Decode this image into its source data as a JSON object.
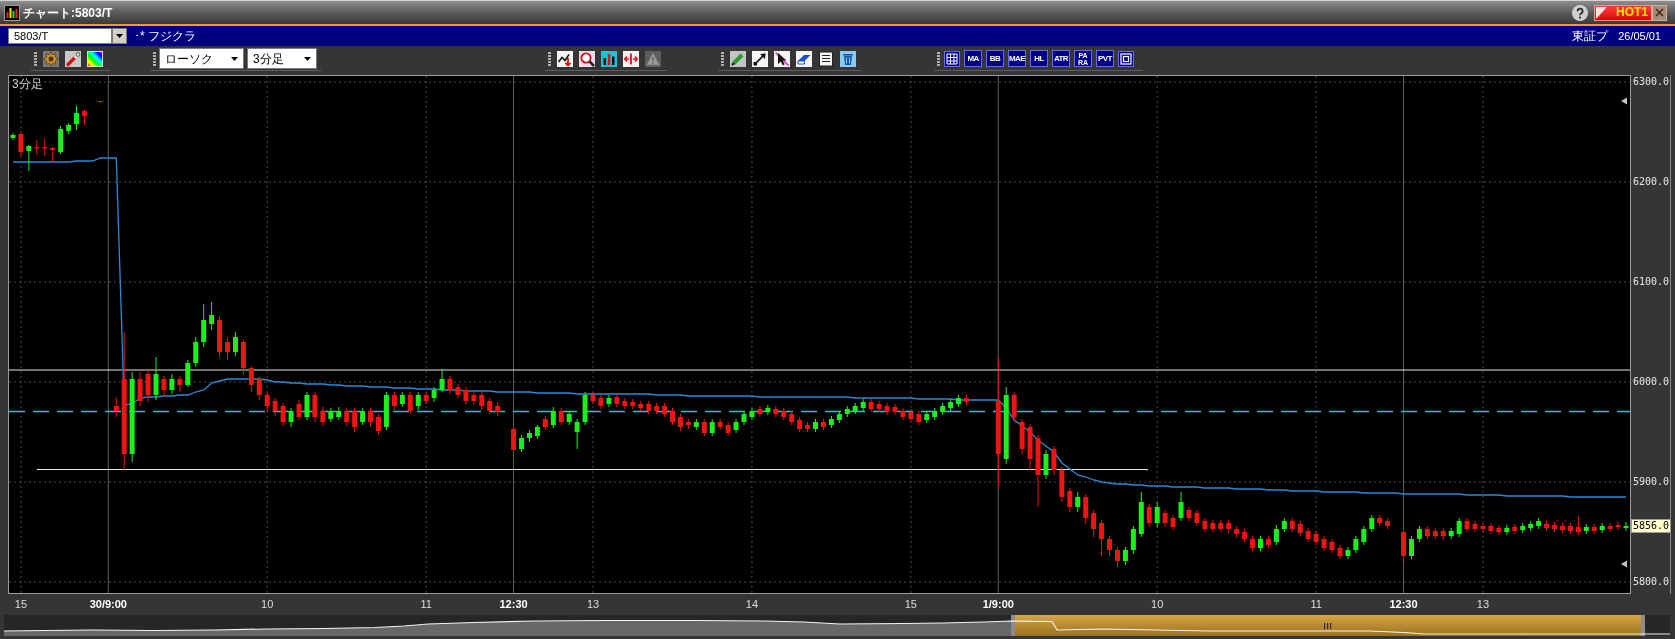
{
  "window": {
    "title": "チャート:5803/T",
    "hot_button": "HOT1"
  },
  "symbol_bar": {
    "symbol": "5803/T",
    "name": "･* フジクラ",
    "market": "東証プ",
    "date": "26/05/01"
  },
  "toolbar": {
    "chart_type": "ローソク",
    "interval": "3分足",
    "analysis_tools": [
      {
        "disabled": false
      },
      {
        "disabled": false
      },
      {
        "disabled": false
      },
      {
        "disabled": false
      },
      {
        "disabled": true
      }
    ],
    "indicators": [
      {
        "label": "MA",
        "kind": "single"
      },
      {
        "label": "BB",
        "kind": "single"
      },
      {
        "label": "MAE",
        "kind": "single"
      },
      {
        "label": "HL",
        "kind": "single"
      },
      {
        "label": "ATR",
        "kind": "single"
      },
      {
        "label": "PARA",
        "kind": "stacked"
      },
      {
        "label": "PVT",
        "kind": "single"
      }
    ]
  },
  "chart": {
    "interval_label": "3分足",
    "last_price": "5856.0",
    "x_tick_styles": [
      {
        "kind": "hour"
      },
      {
        "kind": "session"
      },
      {
        "kind": "hour"
      },
      {
        "kind": "hour"
      },
      {
        "kind": "session"
      },
      {
        "kind": "hour"
      },
      {
        "kind": "hour"
      },
      {
        "kind": "hour"
      },
      {
        "kind": "session"
      },
      {
        "kind": "hour"
      },
      {
        "kind": "hour"
      },
      {
        "kind": "session"
      },
      {
        "kind": "hour"
      }
    ],
    "chart_data": {
      "type": "candlestick",
      "ylim": [
        5789,
        6306
      ],
      "grid": true,
      "yticks": [
        {
          "value": 6300,
          "label": "6300.0"
        },
        {
          "value": 6200,
          "label": "6200.0"
        },
        {
          "value": 6100,
          "label": "6100.0"
        },
        {
          "value": 6000,
          "label": "6000.0"
        },
        {
          "value": 5900,
          "label": "5900.0"
        },
        {
          "value": 5800,
          "label": "5800.0"
        }
      ],
      "ref_lines": [
        {
          "axis": "y",
          "value": 6012,
          "color": "#e8e8e8"
        },
        {
          "axis": "y",
          "value": 5970,
          "color": "#22c4dc"
        },
        {
          "axis": "y",
          "value": 5912,
          "color": "#e8e8e8"
        }
      ],
      "categories": [
        null,
        "15",
        null,
        null,
        null,
        null,
        null,
        null,
        null,
        null,
        null,
        null,
        "30/9:00",
        null,
        null,
        null,
        null,
        null,
        null,
        null,
        null,
        null,
        null,
        null,
        null,
        null,
        null,
        null,
        null,
        null,
        null,
        null,
        "10",
        null,
        null,
        null,
        null,
        null,
        null,
        null,
        null,
        null,
        null,
        null,
        null,
        null,
        null,
        null,
        null,
        null,
        null,
        null,
        "11",
        null,
        null,
        null,
        null,
        null,
        null,
        null,
        null,
        null,
        null,
        "12:30",
        null,
        null,
        null,
        null,
        null,
        null,
        null,
        null,
        null,
        "13",
        null,
        null,
        null,
        null,
        null,
        null,
        null,
        null,
        null,
        null,
        null,
        null,
        null,
        null,
        null,
        null,
        null,
        null,
        null,
        "14",
        null,
        null,
        null,
        null,
        null,
        null,
        null,
        null,
        null,
        null,
        null,
        null,
        null,
        null,
        null,
        null,
        null,
        null,
        null,
        "15",
        null,
        null,
        null,
        null,
        null,
        null,
        null,
        null,
        null,
        null,
        "1/9:00",
        null,
        null,
        null,
        null,
        null,
        null,
        null,
        null,
        null,
        null,
        null,
        null,
        null,
        null,
        null,
        null,
        null,
        null,
        null,
        "10",
        null,
        null,
        null,
        null,
        null,
        null,
        null,
        null,
        null,
        null,
        null,
        null,
        null,
        null,
        null,
        null,
        null,
        null,
        null,
        "11",
        null,
        null,
        null,
        null,
        null,
        null,
        null,
        null,
        null,
        null,
        "12:30",
        null,
        null,
        null,
        null,
        null,
        null,
        null,
        null,
        null,
        "13",
        null,
        null,
        null,
        null,
        null,
        null,
        null,
        null,
        null,
        null,
        null,
        null,
        null,
        null,
        null,
        null,
        null,
        null
      ],
      "ohlc": [
        [
          6244,
          6249,
          6242,
          6247
        ],
        [
          6248,
          6250,
          6226,
          6230
        ],
        [
          6231,
          6237,
          6211,
          6236
        ],
        [
          6235,
          6242,
          6227,
          6235
        ],
        [
          6235,
          6243,
          6226,
          6235
        ],
        [
          6234,
          6235,
          6219,
          6232
        ],
        [
          6230,
          6256,
          6228,
          6253
        ],
        [
          6251,
          6259,
          6248,
          6257
        ],
        [
          6258,
          6276,
          6252,
          6269
        ],
        [
          6271,
          6273,
          6257,
          6266
        ],
        null,
        [
          6281,
          6281,
          6281,
          6281
        ],
        null,
        [
          5976,
          5985,
          5965,
          5971
        ],
        [
          6003,
          6050,
          5912,
          5928
        ],
        [
          5928,
          6010,
          5920,
          6003
        ],
        [
          6003,
          6010,
          5976,
          5981
        ],
        [
          6008,
          6012,
          5980,
          5987
        ],
        [
          5987,
          6025,
          5982,
          6008
        ],
        [
          6003,
          6006,
          5985,
          5992
        ],
        [
          5992,
          6008,
          5988,
          6003
        ],
        [
          6003,
          6006,
          5990,
          5997
        ],
        [
          5997,
          6022,
          5995,
          6019
        ],
        [
          6019,
          6045,
          6015,
          6040
        ],
        [
          6040,
          6078,
          6035,
          6062
        ],
        [
          6058,
          6080,
          6052,
          6067
        ],
        [
          6062,
          6066,
          6025,
          6030
        ],
        [
          6040,
          6045,
          6022,
          6030
        ],
        [
          6030,
          6050,
          6026,
          6045
        ],
        [
          6040,
          6042,
          6008,
          6014
        ],
        [
          6014,
          6016,
          5990,
          5997
        ],
        [
          6003,
          6005,
          5982,
          5987
        ],
        [
          5987,
          5990,
          5970,
          5976
        ],
        [
          5981,
          5984,
          5966,
          5971
        ],
        [
          5976,
          5979,
          5956,
          5960
        ],
        [
          5960,
          5974,
          5955,
          5971
        ],
        [
          5978,
          5982,
          5962,
          5965
        ],
        [
          5965,
          5990,
          5962,
          5987
        ],
        [
          5987,
          5990,
          5960,
          5965
        ],
        [
          5971,
          5975,
          5956,
          5960
        ],
        [
          5963,
          5974,
          5960,
          5971
        ],
        [
          5965,
          5975,
          5962,
          5971
        ],
        [
          5971,
          5974,
          5956,
          5960
        ],
        [
          5971,
          5974,
          5950,
          5955
        ],
        [
          5960,
          5974,
          5957,
          5971
        ],
        [
          5971,
          5974,
          5955,
          5960
        ],
        [
          5965,
          5968,
          5947,
          5951
        ],
        [
          5955,
          5990,
          5952,
          5987
        ],
        [
          5987,
          5990,
          5972,
          5976
        ],
        [
          5978,
          5990,
          5975,
          5987
        ],
        [
          5987,
          5990,
          5968,
          5971
        ],
        [
          5976,
          5990,
          5972,
          5987
        ],
        [
          5987,
          5990,
          5978,
          5981
        ],
        [
          5984,
          5995,
          5980,
          5992
        ],
        [
          5992,
          6013,
          5990,
          6003
        ],
        [
          6003,
          6006,
          5988,
          5992
        ],
        [
          5995,
          5998,
          5984,
          5987
        ],
        [
          5992,
          5995,
          5978,
          5981
        ],
        [
          5987,
          5990,
          5977,
          5981
        ],
        [
          5987,
          5990,
          5972,
          5976
        ],
        [
          5981,
          5984,
          5968,
          5971
        ],
        [
          5976,
          5980,
          5966,
          5970
        ],
        null,
        [
          5953,
          5955,
          5918,
          5932
        ],
        [
          5933,
          5947,
          5930,
          5944
        ],
        [
          5944,
          5952,
          5940,
          5949
        ],
        [
          5946,
          5957,
          5943,
          5955
        ],
        [
          5963,
          5966,
          5952,
          5955
        ],
        [
          5957,
          5975,
          5954,
          5971
        ],
        [
          5971,
          5974,
          5957,
          5960
        ],
        [
          5960,
          5971,
          5957,
          5968
        ],
        [
          5950,
          5963,
          5933,
          5960
        ],
        [
          5960,
          5990,
          5957,
          5987
        ],
        [
          5987,
          5990,
          5978,
          5981
        ],
        [
          5984,
          5987,
          5973,
          5976
        ],
        [
          5978,
          5987,
          5975,
          5984
        ],
        [
          5985,
          5988,
          5975,
          5978
        ],
        [
          5981,
          5984,
          5973,
          5976
        ],
        [
          5980,
          5983,
          5973,
          5976
        ],
        [
          5978,
          5981,
          5971,
          5974
        ],
        [
          5978,
          5981,
          5968,
          5971
        ],
        [
          5976,
          5979,
          5968,
          5971
        ],
        [
          5976,
          5979,
          5965,
          5968
        ],
        [
          5971,
          5974,
          5957,
          5960
        ],
        [
          5965,
          5968,
          5951,
          5955
        ],
        [
          5960,
          5963,
          5953,
          5957
        ],
        [
          5955,
          5963,
          5952,
          5960
        ],
        [
          5960,
          5963,
          5946,
          5949
        ],
        [
          5949,
          5963,
          5946,
          5960
        ],
        [
          5960,
          5963,
          5952,
          5955
        ],
        [
          5957,
          5960,
          5946,
          5949
        ],
        [
          5952,
          5963,
          5949,
          5960
        ],
        [
          5960,
          5971,
          5957,
          5968
        ],
        [
          5965,
          5974,
          5962,
          5971
        ],
        [
          5973,
          5976,
          5965,
          5968
        ],
        [
          5970,
          5977,
          5967,
          5974
        ],
        [
          5973,
          5976,
          5965,
          5968
        ],
        [
          5971,
          5974,
          5962,
          5965
        ],
        [
          5968,
          5971,
          5957,
          5960
        ],
        [
          5962,
          5965,
          5950,
          5953
        ],
        [
          5957,
          5960,
          5950,
          5953
        ],
        [
          5953,
          5963,
          5950,
          5960
        ],
        [
          5960,
          5963,
          5952,
          5955
        ],
        [
          5957,
          5966,
          5954,
          5963
        ],
        [
          5962,
          5971,
          5959,
          5968
        ],
        [
          5968,
          5976,
          5965,
          5973
        ],
        [
          5971,
          5979,
          5968,
          5976
        ],
        [
          5974,
          5983,
          5971,
          5980
        ],
        [
          5980,
          5983,
          5970,
          5973
        ],
        [
          5978,
          5981,
          5970,
          5973
        ],
        [
          5976,
          5979,
          5967,
          5970
        ],
        [
          5975,
          5978,
          5967,
          5970
        ],
        [
          5971,
          5974,
          5962,
          5965
        ],
        [
          5970,
          5973,
          5960,
          5963
        ],
        [
          5968,
          5971,
          5957,
          5960
        ],
        [
          5962,
          5971,
          5959,
          5968
        ],
        [
          5965,
          5974,
          5962,
          5971
        ],
        [
          5970,
          5979,
          5967,
          5976
        ],
        [
          5974,
          5983,
          5971,
          5980
        ],
        [
          5978,
          5987,
          5975,
          5984
        ],
        [
          5984,
          5987,
          5977,
          5980
        ],
        null,
        null,
        null,
        [
          5981,
          6025,
          5896,
          5928
        ],
        [
          5923,
          5995,
          5918,
          5987
        ],
        [
          5987,
          5990,
          5960,
          5965
        ],
        [
          5960,
          5963,
          5928,
          5933
        ],
        [
          5955,
          5958,
          5912,
          5923
        ],
        [
          5944,
          5947,
          5875,
          5907
        ],
        [
          5907,
          5932,
          5903,
          5928
        ],
        [
          5933,
          5936,
          5907,
          5912
        ],
        [
          5912,
          5915,
          5880,
          5885
        ],
        [
          5891,
          5894,
          5870,
          5875
        ],
        [
          5875,
          5890,
          5870,
          5885
        ],
        [
          5885,
          5888,
          5858,
          5864
        ],
        [
          5869,
          5872,
          5845,
          5853
        ],
        [
          5859,
          5862,
          5826,
          5843
        ],
        [
          5843,
          5846,
          5826,
          5832
        ],
        [
          5832,
          5835,
          5815,
          5821
        ],
        [
          5821,
          5835,
          5817,
          5832
        ],
        [
          5832,
          5856,
          5828,
          5853
        ],
        [
          5848,
          5890,
          5845,
          5880
        ],
        [
          5875,
          5878,
          5855,
          5859
        ],
        [
          5859,
          5880,
          5855,
          5875
        ],
        [
          5869,
          5872,
          5855,
          5859
        ],
        [
          5864,
          5867,
          5852,
          5855
        ],
        [
          5864,
          5890,
          5861,
          5880
        ],
        [
          5872,
          5875,
          5861,
          5864
        ],
        [
          5869,
          5872,
          5856,
          5859
        ],
        [
          5861,
          5864,
          5850,
          5853
        ],
        [
          5859,
          5862,
          5850,
          5853
        ],
        [
          5859,
          5862,
          5850,
          5853
        ],
        [
          5859,
          5862,
          5849,
          5853
        ],
        [
          5853,
          5856,
          5844,
          5848
        ],
        [
          5850,
          5853,
          5840,
          5843
        ],
        [
          5843,
          5846,
          5831,
          5834
        ],
        [
          5834,
          5846,
          5831,
          5843
        ],
        [
          5843,
          5846,
          5834,
          5837
        ],
        [
          5840,
          5857,
          5837,
          5853
        ],
        [
          5853,
          5864,
          5850,
          5861
        ],
        [
          5861,
          5864,
          5850,
          5853
        ],
        [
          5858,
          5861,
          5846,
          5849
        ],
        [
          5851,
          5854,
          5840,
          5843
        ],
        [
          5848,
          5851,
          5837,
          5840
        ],
        [
          5843,
          5846,
          5831,
          5834
        ],
        [
          5840,
          5843,
          5829,
          5832
        ],
        [
          5834,
          5837,
          5823,
          5826
        ],
        [
          5826,
          5835,
          5823,
          5832
        ],
        [
          5832,
          5846,
          5829,
          5843
        ],
        [
          5840,
          5856,
          5837,
          5853
        ],
        [
          5853,
          5867,
          5850,
          5864
        ],
        [
          5864,
          5867,
          5856,
          5859
        ],
        [
          5861,
          5864,
          5853,
          5856
        ],
        null,
        [
          5850,
          5853,
          5821,
          5826
        ],
        [
          5826,
          5846,
          5823,
          5843
        ],
        [
          5843,
          5856,
          5840,
          5853
        ],
        [
          5853,
          5856,
          5843,
          5846
        ],
        [
          5851,
          5854,
          5843,
          5846
        ],
        [
          5851,
          5854,
          5842,
          5846
        ],
        [
          5846,
          5854,
          5843,
          5851
        ],
        [
          5848,
          5864,
          5845,
          5861
        ],
        [
          5861,
          5864,
          5850,
          5853
        ],
        [
          5858,
          5861,
          5850,
          5853
        ],
        [
          5856,
          5859,
          5850,
          5853
        ],
        [
          5856,
          5859,
          5848,
          5851
        ],
        [
          5854,
          5857,
          5847,
          5850
        ],
        [
          5850,
          5857,
          5847,
          5854
        ],
        [
          5855,
          5858,
          5848,
          5851
        ],
        [
          5852,
          5859,
          5849,
          5856
        ],
        [
          5854,
          5861,
          5851,
          5858
        ],
        [
          5856,
          5864,
          5853,
          5861
        ],
        [
          5858,
          5861,
          5851,
          5854
        ],
        [
          5857,
          5860,
          5850,
          5853
        ],
        [
          5856,
          5859,
          5849,
          5852
        ],
        [
          5856,
          5859,
          5848,
          5851
        ],
        [
          5855,
          5866,
          5847,
          5850
        ],
        [
          5851,
          5858,
          5848,
          5855
        ],
        [
          5855,
          5858,
          5848,
          5851
        ],
        [
          5852,
          5859,
          5849,
          5856
        ],
        [
          5856,
          5859,
          5850,
          5853
        ],
        [
          5857,
          5860,
          5852,
          5855
        ],
        [
          5854,
          5860,
          5851,
          5856
        ]
      ],
      "series": [
        {
          "type": "line",
          "color": "#2a8ad8",
          "values": [
            6220,
            6220,
            6220,
            6220,
            6220,
            6220,
            6220,
            6220,
            6221,
            6221,
            6221,
            6224,
            6224,
            6224,
            5977,
            5978,
            5984,
            5985,
            5985,
            5986,
            5986,
            5987,
            5987,
            5990,
            5992,
            5999,
            6001,
            6003,
            6003,
            6003,
            6003,
            6003,
            6002,
            6000,
            6000,
            5999,
            5999,
            5998,
            5998,
            5998,
            5997,
            5997,
            5996,
            5996,
            5996,
            5995,
            5995,
            5995,
            5994,
            5994,
            5994,
            5993,
            5993,
            5993,
            5992,
            5992,
            5992,
            5991,
            5991,
            5991,
            5991,
            5990,
            5990,
            5990,
            5990,
            5990,
            5989,
            5989,
            5989,
            5989,
            5989,
            5988,
            5988,
            5988,
            5988,
            5988,
            5988,
            5988,
            5988,
            5988,
            5988,
            5987,
            5987,
            5987,
            5987,
            5986,
            5986,
            5986,
            5986,
            5986,
            5986,
            5986,
            5986,
            5986,
            5985,
            5985,
            5985,
            5985,
            5985,
            5985,
            5985,
            5985,
            5985,
            5985,
            5985,
            5985,
            5984,
            5984,
            5984,
            5984,
            5984,
            5984,
            5984,
            5984,
            5983,
            5983,
            5983,
            5983,
            5983,
            5982,
            5982,
            5982,
            5982,
            5982,
            5982,
            5974,
            5962,
            5956,
            5950,
            5942,
            5936,
            5930,
            5919,
            5913,
            5907,
            5905,
            5902,
            5900,
            5899,
            5898,
            5898,
            5897,
            5897,
            5896,
            5896,
            5896,
            5895,
            5895,
            5895,
            5895,
            5894,
            5894,
            5894,
            5894,
            5893,
            5893,
            5893,
            5893,
            5892,
            5892,
            5892,
            5891,
            5891,
            5891,
            5891,
            5890,
            5890,
            5890,
            5890,
            5890,
            5889,
            5889,
            5889,
            5889,
            5889,
            5888,
            5888,
            5888,
            5888,
            5888,
            5888,
            5888,
            5888,
            5887,
            5887,
            5887,
            5887,
            5887,
            5886,
            5886,
            5886,
            5886,
            5886,
            5886,
            5886,
            5886,
            5885,
            5885,
            5885,
            5885,
            5885,
            5885,
            5885,
            5885
          ]
        }
      ]
    }
  }
}
